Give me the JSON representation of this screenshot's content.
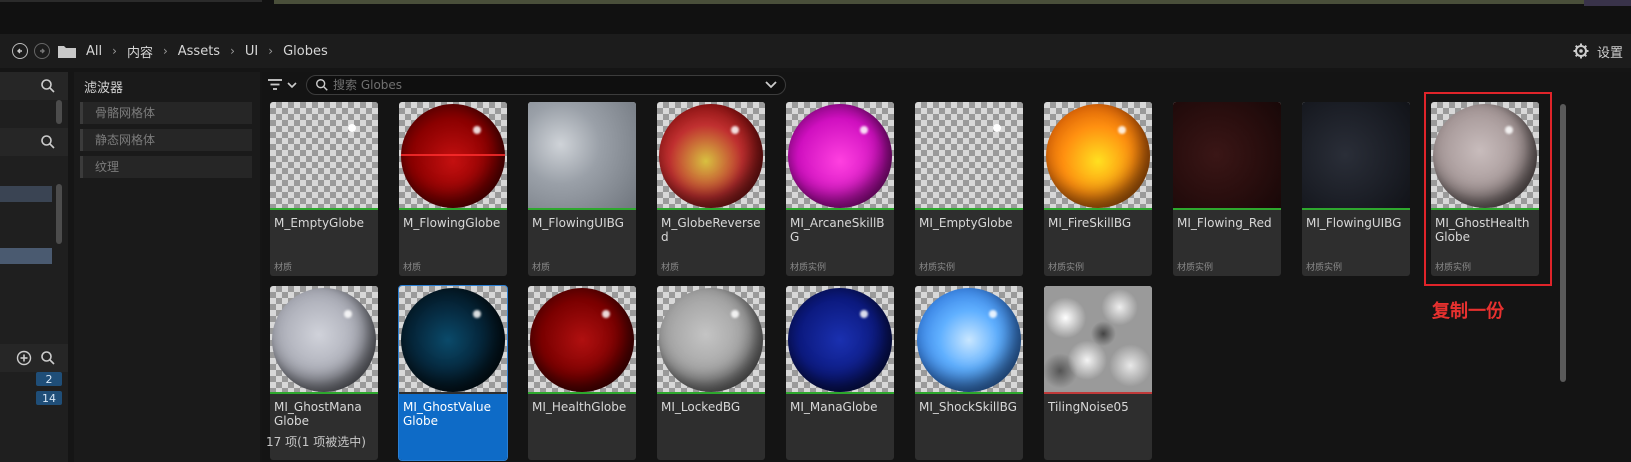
{
  "breadcrumb": [
    "All",
    "内容",
    "Assets",
    "UI",
    "Globes"
  ],
  "settings_label": "设置",
  "filters": {
    "title": "滤波器",
    "items": [
      "骨骼网格体",
      "静态网格体",
      "纹理"
    ]
  },
  "search": {
    "placeholder": "搜索 Globes"
  },
  "left_badges": [
    "2",
    "14"
  ],
  "assets": [
    {
      "name": "M_EmptyGlobe",
      "type": "材质"
    },
    {
      "name": "M_FlowingGlobe",
      "type": "材质"
    },
    {
      "name": "M_FlowingUIBG",
      "type": "材质"
    },
    {
      "name": "M_GlobeReversed",
      "type": "材质"
    },
    {
      "name": "MI_ArcaneSkillBG",
      "type": "材质实例"
    },
    {
      "name": "MI_EmptyGlobe",
      "type": "材质实例"
    },
    {
      "name": "MI_FireSkillBG",
      "type": "材质实例"
    },
    {
      "name": "MI_Flowing_Red",
      "type": "材质实例"
    },
    {
      "name": "MI_FlowingUIBG",
      "type": "材质实例"
    },
    {
      "name": "MI_GhostHealth Globe",
      "type": "材质实例"
    },
    {
      "name": "MI_GhostMana Globe",
      "type": ""
    },
    {
      "name": "MI_GhostValue Globe",
      "type": ""
    },
    {
      "name": "MI_HealthGlobe",
      "type": ""
    },
    {
      "name": "MI_LockedBG",
      "type": ""
    },
    {
      "name": "MI_ManaGlobe",
      "type": ""
    },
    {
      "name": "MI_ShockSkillBG",
      "type": ""
    },
    {
      "name": "TilingNoise05",
      "type": ""
    }
  ],
  "annotation": "复制一份",
  "status": "17 项(1 项被选中)",
  "colors": {
    "accent_selected": "#0e6bc7",
    "annotation_red": "#e0242a",
    "material_line": "#2ea82e"
  }
}
